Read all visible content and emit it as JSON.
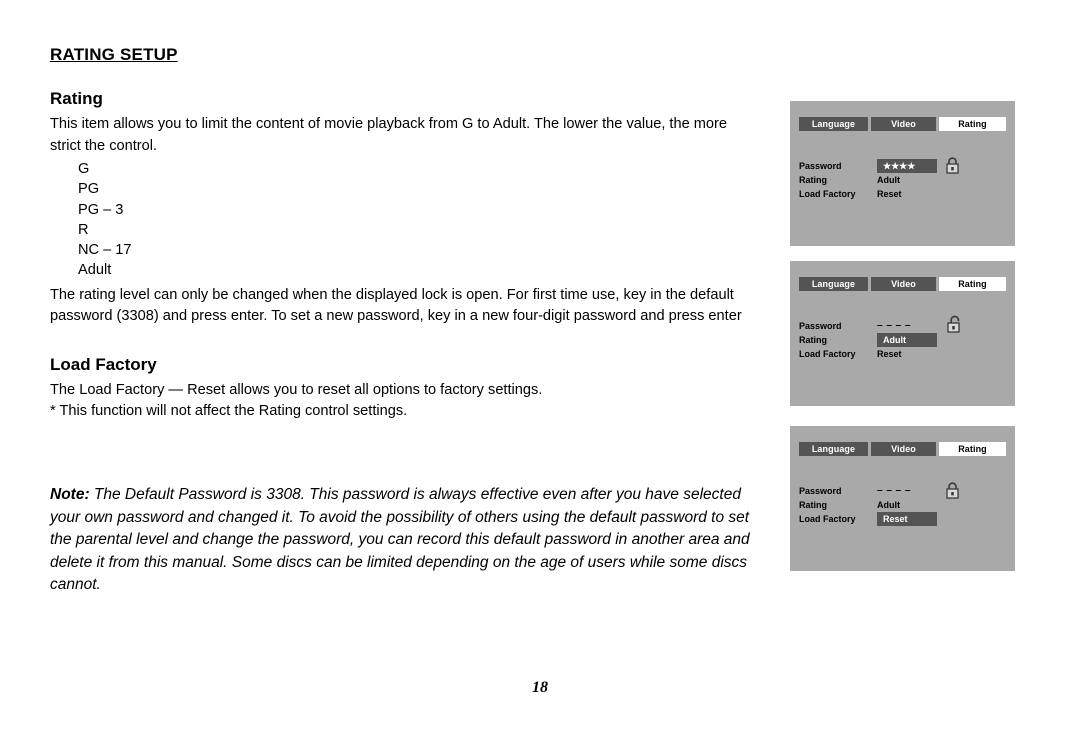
{
  "document": {
    "section_heading": "RATING SETUP",
    "page_number": "18"
  },
  "rating_section": {
    "heading": "Rating",
    "intro": "This item allows you to limit the content of movie playback from G to Adult. The lower the value, the more strict the control.",
    "levels": [
      "G",
      "PG",
      "PG – 3",
      "R",
      "NC – 17",
      "Adult"
    ],
    "detail": "The rating level can only be changed when the displayed lock is open. For first time use, key in the default password (3308) and press enter. To set a new password, key in a new four-digit password and press enter"
  },
  "load_factory_section": {
    "heading": "Load Factory",
    "body": "The Load Factory — Reset allows you to reset all options to factory settings.",
    "footnote": "* This function will not affect the Rating control settings."
  },
  "note": {
    "label": "Note:",
    "text": " The Default Password is 3308. This password is always effective even after you have selected your own password  and changed it. To avoid  the  possibility of others using the default password to set the parental level  and change the password, you can record this  default password in another area  and delete it from this manual. Some discs can be limited  depending on the age of users while some discs cannot."
  },
  "osd_panels": [
    {
      "tabs": [
        {
          "label": "Language",
          "selected": false
        },
        {
          "label": "Video",
          "selected": false
        },
        {
          "label": "Rating",
          "selected": true
        }
      ],
      "rows": [
        {
          "label": "Password",
          "value": "★★★★",
          "highlighted": true
        },
        {
          "label": "Rating",
          "value": "Adult",
          "highlighted": false
        },
        {
          "label": "Load Factory",
          "value": "Reset",
          "highlighted": false
        }
      ],
      "lock_state": "locked",
      "lock_icon": "lock-closed-icon"
    },
    {
      "tabs": [
        {
          "label": "Language",
          "selected": false
        },
        {
          "label": "Video",
          "selected": false
        },
        {
          "label": "Rating",
          "selected": true
        }
      ],
      "rows": [
        {
          "label": "Password",
          "value": "– – – –",
          "highlighted": false
        },
        {
          "label": "Rating",
          "value": "Adult",
          "highlighted": true
        },
        {
          "label": "Load Factory",
          "value": "Reset",
          "highlighted": false
        }
      ],
      "lock_state": "unlocked",
      "lock_icon": "lock-open-icon"
    },
    {
      "tabs": [
        {
          "label": "Language",
          "selected": false
        },
        {
          "label": "Video",
          "selected": false
        },
        {
          "label": "Rating",
          "selected": true
        }
      ],
      "rows": [
        {
          "label": "Password",
          "value": "– – – –",
          "highlighted": false
        },
        {
          "label": "Rating",
          "value": "Adult",
          "highlighted": false
        },
        {
          "label": "Load Factory",
          "value": "Reset",
          "highlighted": true
        }
      ],
      "lock_state": "locked",
      "lock_icon": "lock-closed-icon"
    }
  ],
  "colors": {
    "panel_background": "#a9a9a9",
    "tab_unselected": "#545454",
    "tab_selected": "#ffffff",
    "highlight_box": "#545454",
    "page_background": "#ffffff",
    "text": "#000000"
  }
}
